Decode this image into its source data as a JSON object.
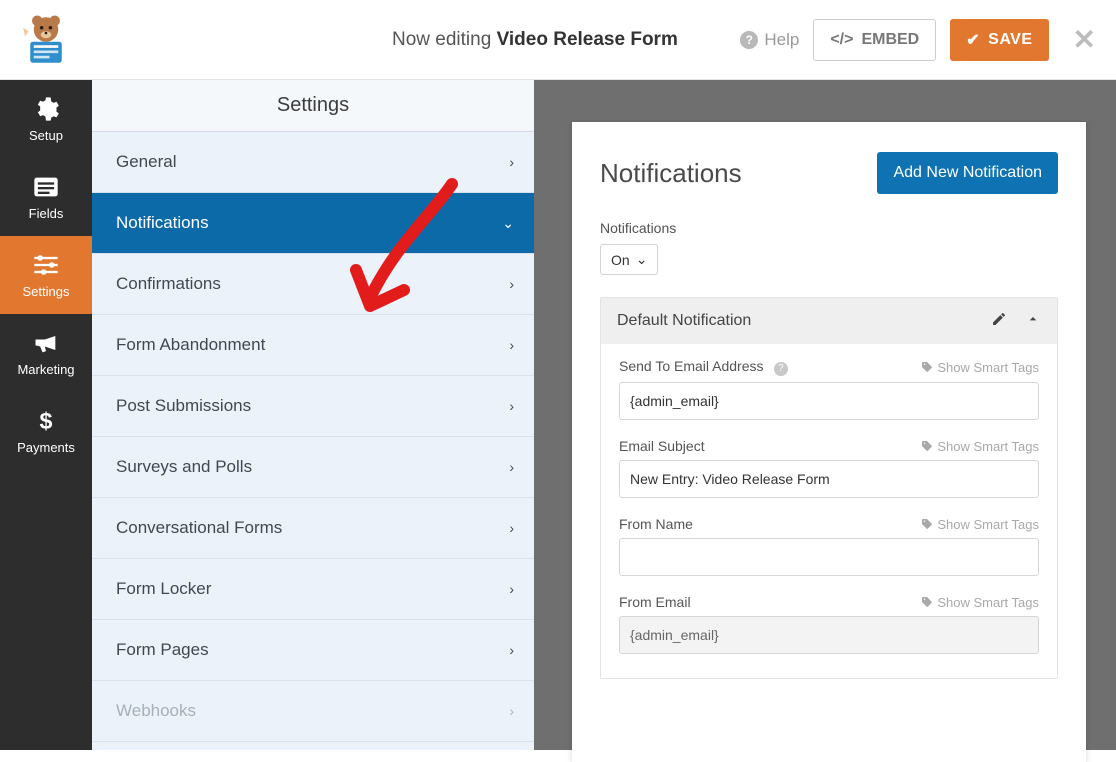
{
  "topbar": {
    "editing_prefix": "Now editing",
    "form_name": "Video Release Form",
    "help_label": "Help",
    "embed_label": "EMBED",
    "save_label": "SAVE"
  },
  "rail": {
    "setup": "Setup",
    "fields": "Fields",
    "settings": "Settings",
    "marketing": "Marketing",
    "payments": "Payments"
  },
  "settings_header": "Settings",
  "menu": {
    "general": "General",
    "notifications": "Notifications",
    "confirmations": "Confirmations",
    "form_abandonment": "Form Abandonment",
    "post_submissions": "Post Submissions",
    "surveys": "Surveys and Polls",
    "conversational": "Conversational Forms",
    "form_locker": "Form Locker",
    "form_pages": "Form Pages",
    "webhooks": "Webhooks"
  },
  "panel": {
    "title": "Notifications",
    "add_new": "Add New Notification",
    "toggle_label": "Notifications",
    "toggle_value": "On",
    "card_title": "Default Notification",
    "fields": {
      "send_to_label": "Send To Email Address",
      "send_to_value": "{admin_email}",
      "subject_label": "Email Subject",
      "subject_value": "New Entry: Video Release Form",
      "from_name_label": "From Name",
      "from_name_value": "",
      "from_email_label": "From Email",
      "from_email_value": "{admin_email}",
      "smart_tags": "Show Smart Tags"
    }
  }
}
